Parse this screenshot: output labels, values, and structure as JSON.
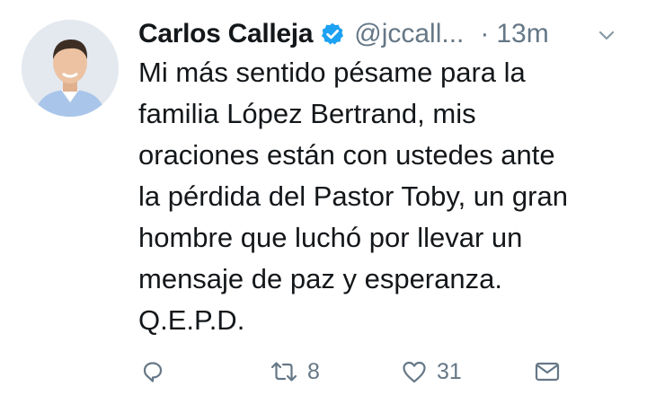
{
  "tweet": {
    "author": {
      "name": "Carlos Calleja",
      "handle": "@jccall...",
      "verified": true
    },
    "time": "13m",
    "separator": "·",
    "text_lines": [
      "Mi más sentido pésame para la",
      "familia López Bertrand, mis",
      "oraciones están con ustedes ante",
      "la pérdida del Pastor Toby, un gran",
      "hombre que luchó por llevar un",
      "mensaje de paz y esperanza.",
      "Q.E.P.D."
    ],
    "actions": {
      "reply": {
        "icon": "reply-icon"
      },
      "retweet": {
        "icon": "retweet-icon",
        "count": "8"
      },
      "like": {
        "icon": "heart-icon",
        "count": "31"
      },
      "direct_message": {
        "icon": "envelope-icon"
      }
    }
  },
  "colors": {
    "text": "#14171a",
    "muted": "#657786",
    "verified": "#1da1f2"
  }
}
